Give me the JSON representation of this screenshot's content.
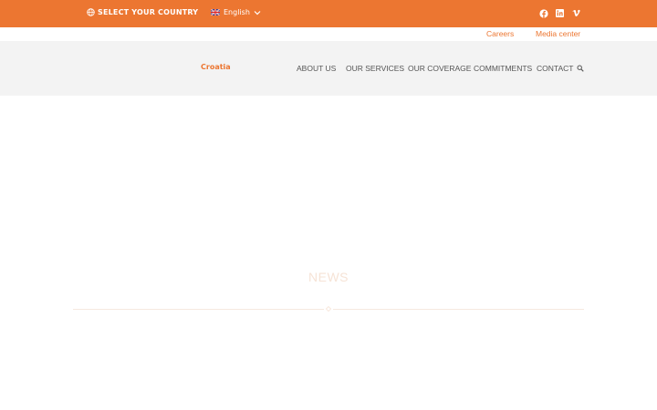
{
  "topbar": {
    "country_label": "SELECT YOUR COUNTRY",
    "language": "English",
    "icons": [
      "globe-icon",
      "uk-flag-icon",
      "chevron-down-icon",
      "facebook-icon",
      "linkedin-icon",
      "vimeo-icon"
    ]
  },
  "subbar": {
    "careers": "Careers",
    "media_center": "Media center"
  },
  "brand": "Croatia",
  "nav": {
    "items": [
      "ABOUT US",
      "OUR SERVICES",
      "OUR COVERAGE",
      "COMMITMENTS",
      "CONTACT"
    ],
    "search_icon": "search-icon"
  },
  "news": {
    "title": "NEWS"
  },
  "colors": {
    "accent": "#ec7631",
    "nav_bg": "#f3f3f3",
    "faded_title": "#f6e3d6",
    "nav_text": "#555555"
  }
}
